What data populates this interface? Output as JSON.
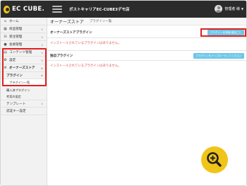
{
  "header": {
    "logo_text": "EC CUBE.",
    "shop_name": "ポストキャリアEC-CUBE3デモ店",
    "user_name": "管理者 様",
    "user_caret": "▼"
  },
  "sidebar": {
    "items": [
      {
        "label": "ホーム",
        "icon": "home-icon",
        "glyph": "⌂"
      },
      {
        "label": "商品管理",
        "icon": "cube-icon",
        "glyph": "▦",
        "caret": "∨"
      },
      {
        "label": "受注管理",
        "icon": "cart-icon",
        "glyph": "⊟",
        "caret": "∨"
      },
      {
        "label": "会員管理",
        "icon": "users-icon",
        "glyph": "●",
        "caret": "∨"
      },
      {
        "label": "コンテンツ管理",
        "icon": "file-icon",
        "glyph": "▤",
        "caret": "∨"
      },
      {
        "label": "設定",
        "icon": "gear-icon",
        "glyph": "✿",
        "caret": "∨"
      },
      {
        "label": "オーナーズストア",
        "icon": "store-icon",
        "glyph": "⚙",
        "caret": "∧"
      }
    ],
    "plugin_group": {
      "label": "プラグイン",
      "caret": "∧"
    },
    "plugin_sub": [
      {
        "label": "プラグイン一覧"
      },
      {
        "label": "購入済プラグイン"
      },
      {
        "label": "考案の設定"
      }
    ],
    "template_group": {
      "label": "テンプレート",
      "caret": "∨"
    },
    "settings_item": {
      "label": "認証キー設定"
    }
  },
  "main": {
    "title": "オーナーズストア",
    "subtitle": "プラグイン一覧",
    "panels": [
      {
        "title": "オーナーズストアプラグイン",
        "button": "プラグインを検索/追加ごと",
        "message": "インストールされているプラグインはありません。"
      },
      {
        "title": "独自プラグイン",
        "button": "プラグインをアップロードしてください",
        "message": "インストールされているプラグインはありません。"
      }
    ]
  },
  "colors": {
    "header_bg": "#2b2b2b",
    "highlight": "#e02020",
    "button_bg": "#6ec6e8",
    "zoom_bg": "#f0c419",
    "message": "#d9534f"
  },
  "zoom_button": {
    "icon": "zoom-in-icon"
  }
}
